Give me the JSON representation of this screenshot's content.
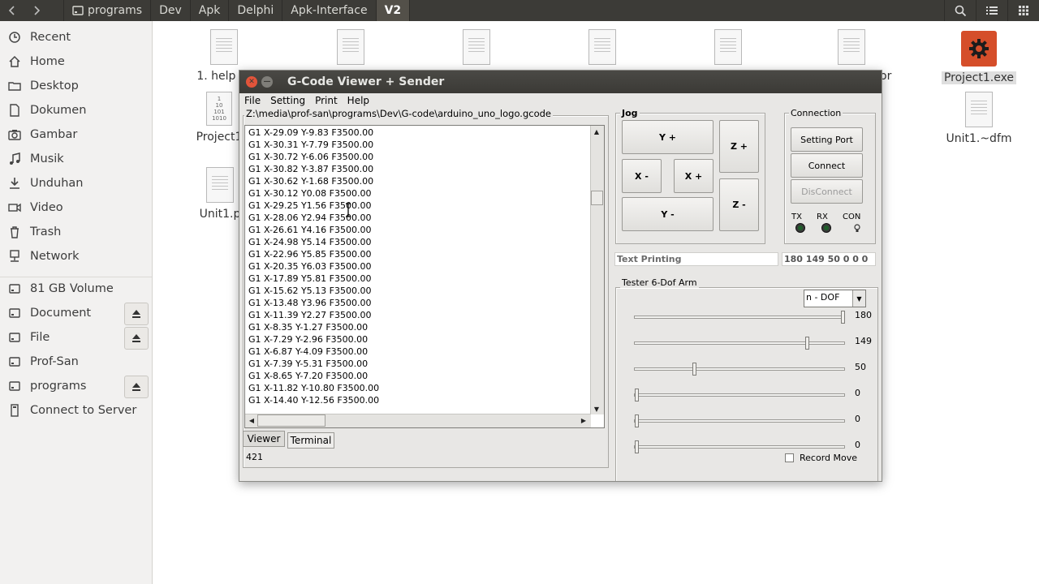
{
  "topbar": {
    "crumbs": [
      "programs",
      "Dev",
      "Apk",
      "Delphi",
      "Apk-Interface",
      "V2"
    ],
    "icons": [
      "back-icon",
      "forward-icon",
      "search-icon",
      "list-view-icon",
      "grid-view-icon"
    ]
  },
  "sidebar": {
    "items": [
      {
        "label": "Recent",
        "icon": "clock-icon"
      },
      {
        "label": "Home",
        "icon": "home-icon"
      },
      {
        "label": "Desktop",
        "icon": "folder-icon"
      },
      {
        "label": "Dokumen",
        "icon": "document-icon"
      },
      {
        "label": "Gambar",
        "icon": "camera-icon"
      },
      {
        "label": "Musik",
        "icon": "music-icon"
      },
      {
        "label": "Unduhan",
        "icon": "download-icon"
      },
      {
        "label": "Video",
        "icon": "video-icon"
      },
      {
        "label": "Trash",
        "icon": "trash-icon"
      },
      {
        "label": "Network",
        "icon": "network-icon"
      }
    ],
    "devices": [
      {
        "label": "81 GB Volume",
        "icon": "drive-icon",
        "eject": false
      },
      {
        "label": "Document",
        "icon": "drive-icon",
        "eject": true
      },
      {
        "label": "File",
        "icon": "drive-icon",
        "eject": true
      },
      {
        "label": "Prof-San",
        "icon": "drive-icon",
        "eject": false
      },
      {
        "label": "programs",
        "icon": "drive-icon",
        "eject": true
      },
      {
        "label": "Connect to Server",
        "icon": "server-icon",
        "eject": false
      }
    ]
  },
  "desktop": {
    "files": [
      {
        "label": "1. help Fil"
      },
      {
        "label": "Project1"
      },
      {
        "label": "Unit1.p"
      },
      {
        "label": "or"
      },
      {
        "label": "Project1.exe"
      },
      {
        "label": "Unit1.~dfm"
      }
    ]
  },
  "app": {
    "title": "G-Code Viewer + Sender",
    "menu": [
      "File",
      "Setting",
      "Print",
      "Help"
    ],
    "filepath": "Z:\\media\\prof-san\\programs\\Dev\\G-code\\arduino_uno_logo.gcode",
    "gcode_lines": [
      "G1 X-29.09 Y-9.83 F3500.00",
      "G1 X-30.31 Y-7.79 F3500.00",
      "G1 X-30.72 Y-6.06 F3500.00",
      "G1 X-30.82 Y-3.87 F3500.00",
      "G1 X-30.62 Y-1.68 F3500.00",
      "G1 X-30.12 Y0.08 F3500.00",
      "G1 X-29.25 Y1.56 F3500.00",
      "G1 X-28.06 Y2.94 F3500.00",
      "G1 X-26.61 Y4.16 F3500.00",
      "G1 X-24.98 Y5.14 F3500.00",
      "G1 X-22.96 Y5.85 F3500.00",
      "G1 X-20.35 Y6.03 F3500.00",
      "G1 X-17.89 Y5.81 F3500.00",
      "G1 X-15.62 Y5.13 F3500.00",
      "G1 X-13.48 Y3.96 F3500.00",
      "G1 X-11.39 Y2.27 F3500.00",
      "G1 X-8.35 Y-1.27 F3500.00",
      "G1 X-7.29 Y-2.96 F3500.00",
      "G1 X-6.87 Y-4.09 F3500.00",
      "G1 X-7.39 Y-5.31 F3500.00",
      "G1 X-8.65 Y-7.20 F3500.00",
      "G1 X-11.82 Y-10.80 F3500.00",
      "G1 X-14.40 Y-12.56 F3500.00"
    ],
    "tabs": [
      "Viewer",
      "Terminal"
    ],
    "line_count": "421",
    "jog": {
      "title": "Jog",
      "y_plus": "Y +",
      "y_minus": "Y -",
      "x_minus": "X -",
      "x_plus": "X +",
      "z_plus": "Z +",
      "z_minus": "Z -"
    },
    "connection": {
      "title": "Connection",
      "setting_port": "Setting Port",
      "connect": "Connect",
      "disconnect": "DisConnect",
      "tx": "TX",
      "rx": "RX",
      "con": "CON"
    },
    "status_field": "Text Printing",
    "values_field": "180 149 50 0 0 0",
    "tester": {
      "title": "Tester 6-Dof Arm",
      "dof_select": "n - DOF",
      "sliders": [
        {
          "value": 180,
          "max": 180
        },
        {
          "value": 149,
          "max": 180
        },
        {
          "value": 50,
          "max": 180
        },
        {
          "value": 0,
          "max": 180
        },
        {
          "value": 0,
          "max": 180
        },
        {
          "value": 0,
          "max": 180
        }
      ],
      "slider_labels": [
        "180",
        "149",
        "50",
        "0",
        "0",
        "0"
      ],
      "record_move": "Record Move"
    }
  }
}
